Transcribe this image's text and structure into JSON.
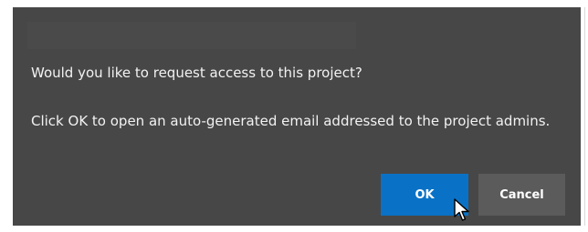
{
  "dialog": {
    "question": "Would you like to request access to this project?",
    "message": "Click OK to open an auto-generated email addressed to the project admins.",
    "ok_label": "OK",
    "cancel_label": "Cancel"
  },
  "colors": {
    "dialog_background": "#474747",
    "primary_button": "#0a72c6",
    "secondary_button": "#5b5b5b",
    "text": "#f2f2f2"
  },
  "icons": {
    "cursor": "mouse-pointer-icon"
  }
}
